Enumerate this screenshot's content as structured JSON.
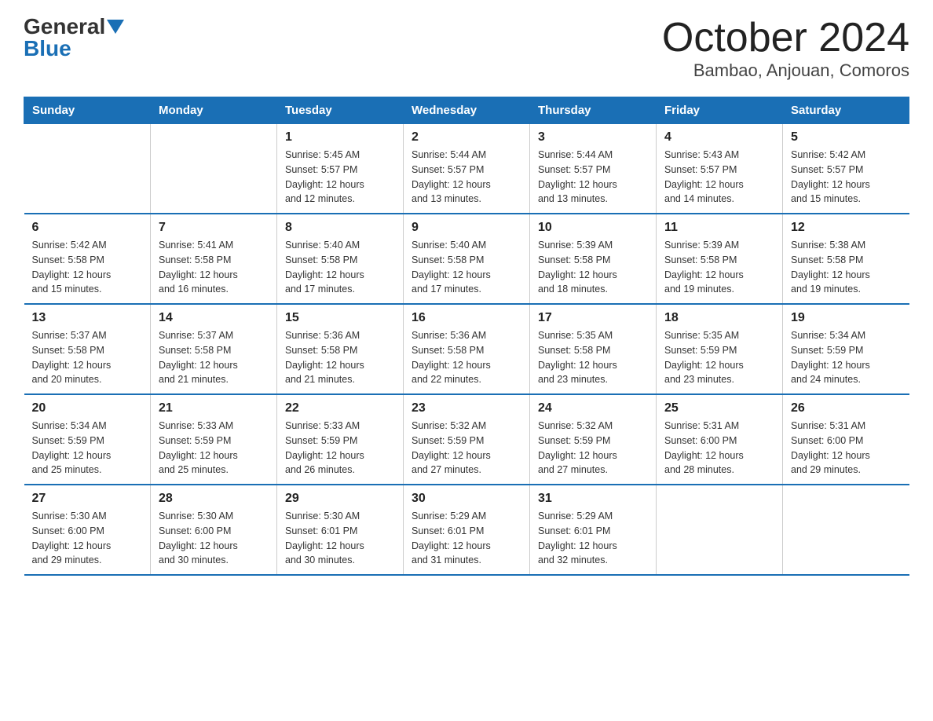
{
  "logo": {
    "part1": "General",
    "part2": "Blue"
  },
  "title": "October 2024",
  "subtitle": "Bambao, Anjouan, Comoros",
  "headers": [
    "Sunday",
    "Monday",
    "Tuesday",
    "Wednesday",
    "Thursday",
    "Friday",
    "Saturday"
  ],
  "weeks": [
    [
      {
        "day": "",
        "info": ""
      },
      {
        "day": "",
        "info": ""
      },
      {
        "day": "1",
        "info": "Sunrise: 5:45 AM\nSunset: 5:57 PM\nDaylight: 12 hours\nand 12 minutes."
      },
      {
        "day": "2",
        "info": "Sunrise: 5:44 AM\nSunset: 5:57 PM\nDaylight: 12 hours\nand 13 minutes."
      },
      {
        "day": "3",
        "info": "Sunrise: 5:44 AM\nSunset: 5:57 PM\nDaylight: 12 hours\nand 13 minutes."
      },
      {
        "day": "4",
        "info": "Sunrise: 5:43 AM\nSunset: 5:57 PM\nDaylight: 12 hours\nand 14 minutes."
      },
      {
        "day": "5",
        "info": "Sunrise: 5:42 AM\nSunset: 5:57 PM\nDaylight: 12 hours\nand 15 minutes."
      }
    ],
    [
      {
        "day": "6",
        "info": "Sunrise: 5:42 AM\nSunset: 5:58 PM\nDaylight: 12 hours\nand 15 minutes."
      },
      {
        "day": "7",
        "info": "Sunrise: 5:41 AM\nSunset: 5:58 PM\nDaylight: 12 hours\nand 16 minutes."
      },
      {
        "day": "8",
        "info": "Sunrise: 5:40 AM\nSunset: 5:58 PM\nDaylight: 12 hours\nand 17 minutes."
      },
      {
        "day": "9",
        "info": "Sunrise: 5:40 AM\nSunset: 5:58 PM\nDaylight: 12 hours\nand 17 minutes."
      },
      {
        "day": "10",
        "info": "Sunrise: 5:39 AM\nSunset: 5:58 PM\nDaylight: 12 hours\nand 18 minutes."
      },
      {
        "day": "11",
        "info": "Sunrise: 5:39 AM\nSunset: 5:58 PM\nDaylight: 12 hours\nand 19 minutes."
      },
      {
        "day": "12",
        "info": "Sunrise: 5:38 AM\nSunset: 5:58 PM\nDaylight: 12 hours\nand 19 minutes."
      }
    ],
    [
      {
        "day": "13",
        "info": "Sunrise: 5:37 AM\nSunset: 5:58 PM\nDaylight: 12 hours\nand 20 minutes."
      },
      {
        "day": "14",
        "info": "Sunrise: 5:37 AM\nSunset: 5:58 PM\nDaylight: 12 hours\nand 21 minutes."
      },
      {
        "day": "15",
        "info": "Sunrise: 5:36 AM\nSunset: 5:58 PM\nDaylight: 12 hours\nand 21 minutes."
      },
      {
        "day": "16",
        "info": "Sunrise: 5:36 AM\nSunset: 5:58 PM\nDaylight: 12 hours\nand 22 minutes."
      },
      {
        "day": "17",
        "info": "Sunrise: 5:35 AM\nSunset: 5:58 PM\nDaylight: 12 hours\nand 23 minutes."
      },
      {
        "day": "18",
        "info": "Sunrise: 5:35 AM\nSunset: 5:59 PM\nDaylight: 12 hours\nand 23 minutes."
      },
      {
        "day": "19",
        "info": "Sunrise: 5:34 AM\nSunset: 5:59 PM\nDaylight: 12 hours\nand 24 minutes."
      }
    ],
    [
      {
        "day": "20",
        "info": "Sunrise: 5:34 AM\nSunset: 5:59 PM\nDaylight: 12 hours\nand 25 minutes."
      },
      {
        "day": "21",
        "info": "Sunrise: 5:33 AM\nSunset: 5:59 PM\nDaylight: 12 hours\nand 25 minutes."
      },
      {
        "day": "22",
        "info": "Sunrise: 5:33 AM\nSunset: 5:59 PM\nDaylight: 12 hours\nand 26 minutes."
      },
      {
        "day": "23",
        "info": "Sunrise: 5:32 AM\nSunset: 5:59 PM\nDaylight: 12 hours\nand 27 minutes."
      },
      {
        "day": "24",
        "info": "Sunrise: 5:32 AM\nSunset: 5:59 PM\nDaylight: 12 hours\nand 27 minutes."
      },
      {
        "day": "25",
        "info": "Sunrise: 5:31 AM\nSunset: 6:00 PM\nDaylight: 12 hours\nand 28 minutes."
      },
      {
        "day": "26",
        "info": "Sunrise: 5:31 AM\nSunset: 6:00 PM\nDaylight: 12 hours\nand 29 minutes."
      }
    ],
    [
      {
        "day": "27",
        "info": "Sunrise: 5:30 AM\nSunset: 6:00 PM\nDaylight: 12 hours\nand 29 minutes."
      },
      {
        "day": "28",
        "info": "Sunrise: 5:30 AM\nSunset: 6:00 PM\nDaylight: 12 hours\nand 30 minutes."
      },
      {
        "day": "29",
        "info": "Sunrise: 5:30 AM\nSunset: 6:01 PM\nDaylight: 12 hours\nand 30 minutes."
      },
      {
        "day": "30",
        "info": "Sunrise: 5:29 AM\nSunset: 6:01 PM\nDaylight: 12 hours\nand 31 minutes."
      },
      {
        "day": "31",
        "info": "Sunrise: 5:29 AM\nSunset: 6:01 PM\nDaylight: 12 hours\nand 32 minutes."
      },
      {
        "day": "",
        "info": ""
      },
      {
        "day": "",
        "info": ""
      }
    ]
  ]
}
